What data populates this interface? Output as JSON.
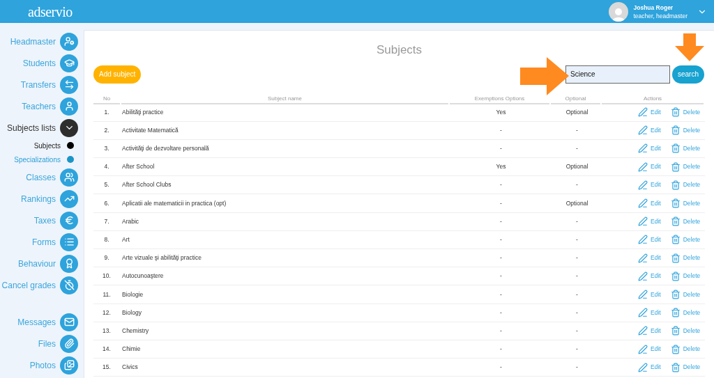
{
  "header": {
    "logo": "adservio",
    "user": {
      "name": "Joshua Roger",
      "role": "teacher, headmaster"
    }
  },
  "sidebar": {
    "groups": [
      [
        {
          "label": "Headmaster",
          "kind": "main",
          "selected": false
        },
        {
          "label": "Students",
          "kind": "main",
          "selected": false
        },
        {
          "label": "Transfers",
          "kind": "main",
          "selected": false
        },
        {
          "label": "Teachers",
          "kind": "main",
          "selected": false
        },
        {
          "label": "Subjects lists",
          "kind": "main",
          "selected": true
        },
        {
          "label": "Subjects",
          "kind": "sub",
          "selected": true
        },
        {
          "label": "Specializations",
          "kind": "sub",
          "selected": false
        },
        {
          "label": "Classes",
          "kind": "main",
          "selected": false
        },
        {
          "label": "Rankings",
          "kind": "main",
          "selected": false
        },
        {
          "label": "Taxes",
          "kind": "main",
          "selected": false
        },
        {
          "label": "Forms",
          "kind": "main",
          "selected": false
        },
        {
          "label": "Behaviour",
          "kind": "main",
          "selected": false
        },
        {
          "label": "Cancel grades",
          "kind": "main",
          "selected": false
        }
      ],
      [
        {
          "label": "Messages",
          "kind": "main",
          "selected": false
        },
        {
          "label": "Files",
          "kind": "main",
          "selected": false
        },
        {
          "label": "Photos",
          "kind": "main",
          "selected": false
        }
      ]
    ]
  },
  "page": {
    "title": "Subjects",
    "add_button": "Add subject",
    "search": {
      "value": "Science",
      "button": "search"
    }
  },
  "table": {
    "columns": [
      "No",
      "Subject name",
      "Exemptions Options",
      "Optional",
      "Actions"
    ],
    "rows": [
      {
        "no": "1.",
        "name": "Abilităţi practice",
        "exemptions": "Yes",
        "optional": "Optional",
        "edit": "Edit",
        "delete": "Delete"
      },
      {
        "no": "2.",
        "name": "Activitate Matematică",
        "exemptions": "-",
        "optional": "-",
        "edit": "Edit",
        "delete": "Delete"
      },
      {
        "no": "3.",
        "name": "Activităţi de dezvoltare personală",
        "exemptions": "-",
        "optional": "-",
        "edit": "Edit",
        "delete": "Delete"
      },
      {
        "no": "4.",
        "name": "After School",
        "exemptions": "Yes",
        "optional": "Optional",
        "edit": "Edit",
        "delete": "Delete"
      },
      {
        "no": "5.",
        "name": "After School Clubs",
        "exemptions": "-",
        "optional": "-",
        "edit": "Edit",
        "delete": "Delete"
      },
      {
        "no": "6.",
        "name": "Aplicatii ale matematicii in practica (opt)",
        "exemptions": "-",
        "optional": "Optional",
        "edit": "Edit",
        "delete": "Delete"
      },
      {
        "no": "7.",
        "name": "Arabic",
        "exemptions": "-",
        "optional": "-",
        "edit": "Edit",
        "delete": "Delete"
      },
      {
        "no": "8.",
        "name": "Art",
        "exemptions": "-",
        "optional": "-",
        "edit": "Edit",
        "delete": "Delete"
      },
      {
        "no": "9.",
        "name": "Arte vizuale şi abilităţi practice",
        "exemptions": "-",
        "optional": "-",
        "edit": "Edit",
        "delete": "Delete"
      },
      {
        "no": "10.",
        "name": "Autocunoaştere",
        "exemptions": "-",
        "optional": "-",
        "edit": "Edit",
        "delete": "Delete"
      },
      {
        "no": "11.",
        "name": "Biologie",
        "exemptions": "-",
        "optional": "-",
        "edit": "Edit",
        "delete": "Delete"
      },
      {
        "no": "12.",
        "name": "Biology",
        "exemptions": "-",
        "optional": "-",
        "edit": "Edit",
        "delete": "Delete"
      },
      {
        "no": "13.",
        "name": "Chemistry",
        "exemptions": "-",
        "optional": "-",
        "edit": "Edit",
        "delete": "Delete"
      },
      {
        "no": "14.",
        "name": "Chimie",
        "exemptions": "-",
        "optional": "-",
        "edit": "Edit",
        "delete": "Delete"
      },
      {
        "no": "15.",
        "name": "Civics",
        "exemptions": "-",
        "optional": "-",
        "edit": "Edit",
        "delete": "Delete"
      }
    ]
  }
}
